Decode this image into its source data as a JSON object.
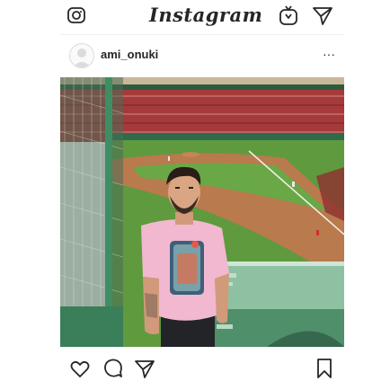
{
  "header": {
    "brand": "Instagram",
    "icons": {
      "camera": "camera-icon",
      "igtv": "igtv-icon",
      "direct": "direct-message-icon"
    }
  },
  "post": {
    "username": "ami_onuki",
    "more_label": "···",
    "photo_alt": "Man in pink t-shirt standing in the stands above a baseball field",
    "actions": {
      "like": "heart-icon",
      "comment": "comment-icon",
      "share": "share-icon",
      "save": "bookmark-icon"
    }
  },
  "colors": {
    "text": "#262626",
    "grass": "#5f9a3f",
    "infield_dirt": "#b97a4d",
    "railing_green": "#4f8f6a",
    "shirt_pink": "#f2b8cf"
  }
}
